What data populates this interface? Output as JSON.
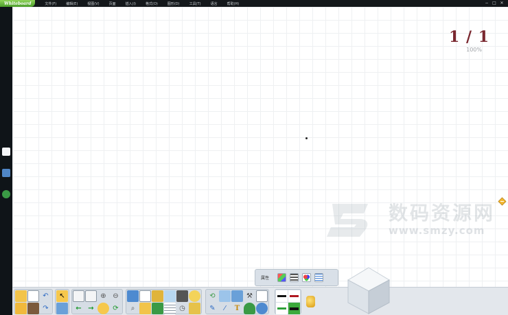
{
  "app": {
    "title": "Whiteboard"
  },
  "menu": [
    "文件(F)",
    "编辑(E)",
    "视图(V)",
    "页面",
    "插入(I)",
    "格式(O)",
    "图形(D)",
    "工具(T)",
    "语言",
    "帮助(H)"
  ],
  "window_controls": [
    "−",
    "□",
    "✕"
  ],
  "canvas": {
    "page_indicator": "1 / 1",
    "zoom": "100%"
  },
  "property_panel": {
    "label": "属性"
  },
  "watermark": {
    "text": "数码资源网",
    "url": "www.smzy.com"
  },
  "colors": {
    "menubar": "#14181b",
    "accent_page": "#7a2830",
    "brand_green": "#4a9e2a"
  },
  "toolbar_groups": [
    {
      "name": "file",
      "cols": 3,
      "icons": [
        "open-folder-icon",
        "copy-pages-icon",
        "undo-icon",
        "folder-icon",
        "paste-icon",
        "redo-icon"
      ]
    },
    {
      "name": "select",
      "cols": 1,
      "icons": [
        "pointer-icon",
        "screen-icon"
      ]
    },
    {
      "name": "navigation",
      "cols": 4,
      "icons": [
        "prev-page-icon",
        "new-page-icon",
        "zoom-in-icon",
        "zoom-out-icon",
        "back-arrow-icon",
        "forward-arrow-icon",
        "hand-icon",
        "refresh-icon"
      ]
    },
    {
      "name": "tools",
      "cols": 6,
      "icons": [
        "screen-shade-icon",
        "spotlight-icon",
        "brush-icon",
        "image-icon",
        "film-icon",
        "bulb-icon",
        "magnifier-icon",
        "photo-icon",
        "calculator-icon",
        "table-icon",
        "clock-icon",
        "paint-icon"
      ]
    },
    {
      "name": "drawing",
      "cols": 5,
      "icons": [
        "rotate-icon",
        "screenshot-icon",
        "chart-icon",
        "tool-icon",
        "edit-doc-icon",
        "pen-icon",
        "highlighter-icon",
        "text-icon",
        "user-icon",
        "audio-icon"
      ]
    }
  ]
}
